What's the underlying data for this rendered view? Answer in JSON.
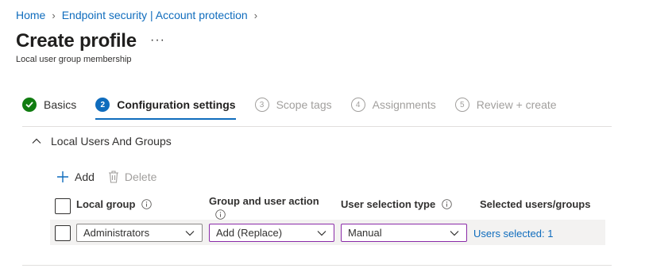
{
  "breadcrumb": {
    "home": "Home",
    "section": "Endpoint security | Account protection"
  },
  "page": {
    "title": "Create profile",
    "more": "···",
    "subtitle": "Local user group membership"
  },
  "steps": [
    {
      "number": "",
      "label": "Basics",
      "state": "done"
    },
    {
      "number": "2",
      "label": "Configuration settings",
      "state": "active"
    },
    {
      "number": "3",
      "label": "Scope tags",
      "state": "pending"
    },
    {
      "number": "4",
      "label": "Assignments",
      "state": "pending"
    },
    {
      "number": "5",
      "label": "Review + create",
      "state": "pending"
    }
  ],
  "section": {
    "title": "Local Users And Groups"
  },
  "toolbar": {
    "add_label": "Add",
    "delete_label": "Delete"
  },
  "table": {
    "columns": {
      "local_group": "Local group",
      "action": "Group and user action",
      "selection_type": "User selection type",
      "selected": "Selected users/groups"
    },
    "rows": [
      {
        "local_group": "Administrators",
        "action": "Add (Replace)",
        "selection_type": "Manual",
        "selected": "Users selected: 1"
      }
    ]
  },
  "colors": {
    "accent": "#0f6cbd",
    "success": "#107c10",
    "focus_border": "#8a2ba8"
  }
}
